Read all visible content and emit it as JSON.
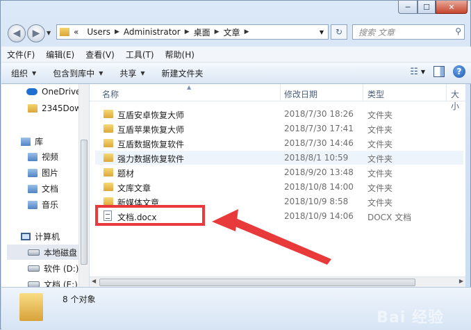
{
  "window": {
    "controls": {
      "minimize": "─",
      "maximize": "☐",
      "close": "✕"
    }
  },
  "address": {
    "prefix": "«",
    "segments": [
      "Users",
      "Administrator",
      "桌面",
      "文章"
    ],
    "search_placeholder": "搜索 文章"
  },
  "menubar": [
    "文件(F)",
    "编辑(E)",
    "查看(V)",
    "工具(T)",
    "帮助(H)"
  ],
  "toolbar": {
    "organize": "组织",
    "include_library": "包含到库中",
    "share": "共享",
    "new_folder": "新建文件夹",
    "help": "?"
  },
  "nav": {
    "onedrive": "OneDrive",
    "folder_2345": "2345Dow",
    "libraries": "库",
    "videos": "视频",
    "pictures": "图片",
    "documents": "文档",
    "music": "音乐",
    "computer": "计算机",
    "local_disk": "本地磁盘",
    "drive_d": "软件 (D:)",
    "drive_e": "文档 (E:)"
  },
  "columns": {
    "name": "名称",
    "date": "修改日期",
    "type": "类型",
    "size": "大小"
  },
  "files": [
    {
      "name": "互盾安卓恢复大师",
      "date": "2018/7/30 18:26",
      "type": "文件夹",
      "kind": "folder"
    },
    {
      "name": "互盾苹果恢复大师",
      "date": "2018/7/30 17:41",
      "type": "文件夹",
      "kind": "folder"
    },
    {
      "name": "互盾数据恢复软件",
      "date": "2018/7/30 14:46",
      "type": "文件夹",
      "kind": "folder"
    },
    {
      "name": "强力数据恢复软件",
      "date": "2018/8/1 10:59",
      "type": "文件夹",
      "kind": "folder"
    },
    {
      "name": "题材",
      "date": "2018/9/20 13:48",
      "type": "文件夹",
      "kind": "folder"
    },
    {
      "name": "文库文章",
      "date": "2018/10/8 14:00",
      "type": "文件夹",
      "kind": "folder"
    },
    {
      "name": "新媒体文章",
      "date": "2018/10/9 8:58",
      "type": "文件夹",
      "kind": "folder"
    },
    {
      "name": "文档.docx",
      "date": "2018/10/9 14:06",
      "type": "DOCX 文档",
      "kind": "docx"
    }
  ],
  "status": {
    "count_text": "8 个对象"
  },
  "watermark": "Bai 经验",
  "colors": {
    "annotation": "#e83a3a",
    "selection": "#e4e9f1"
  }
}
